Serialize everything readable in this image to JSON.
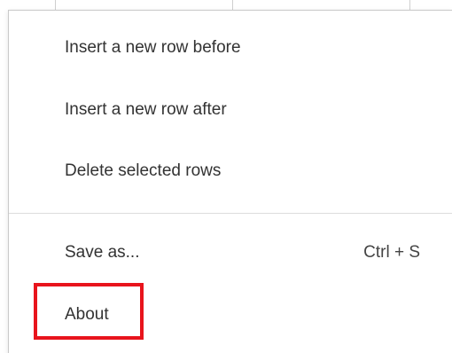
{
  "menu": {
    "items": [
      {
        "label": "Insert a new row before",
        "shortcut": ""
      },
      {
        "label": "Insert a new row after",
        "shortcut": ""
      },
      {
        "label": "Delete selected rows",
        "shortcut": ""
      },
      {
        "label": "Save as...",
        "shortcut": "Ctrl + S"
      },
      {
        "label": "About",
        "shortcut": ""
      }
    ]
  },
  "colors": {
    "highlight": "#e8141c",
    "text": "#333333",
    "separator": "#dcdcdc"
  }
}
